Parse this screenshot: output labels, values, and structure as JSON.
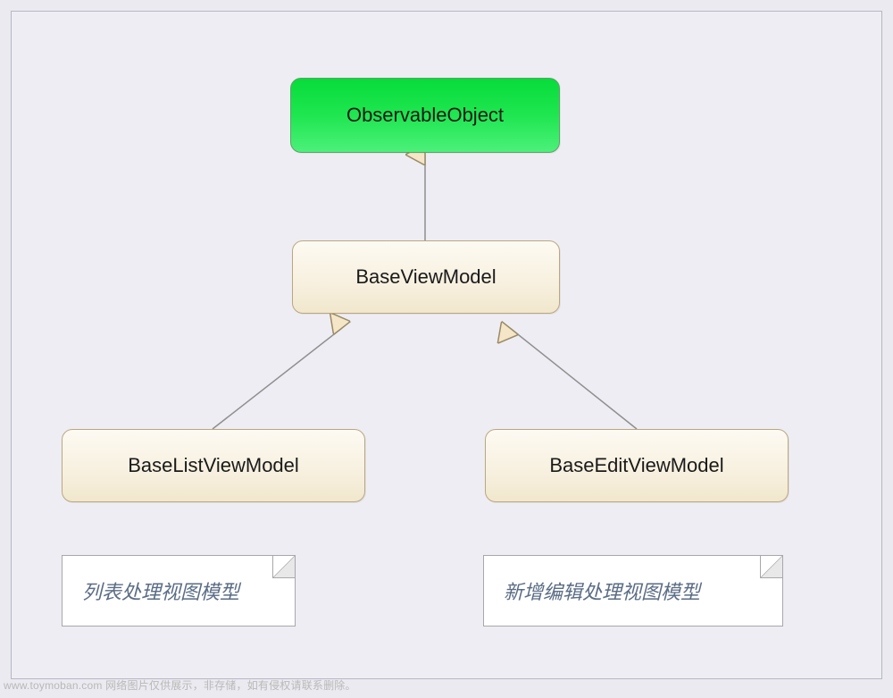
{
  "diagram": {
    "nodes": {
      "root": "ObservableObject",
      "base": "BaseViewModel",
      "list": "BaseListViewModel",
      "edit": "BaseEditViewModel"
    },
    "notes": {
      "list": "列表处理视图模型",
      "edit": "新增编辑处理视图模型"
    }
  },
  "watermark": "www.toymoban.com 网络图片仅供展示，非存储，如有侵权请联系删除。"
}
